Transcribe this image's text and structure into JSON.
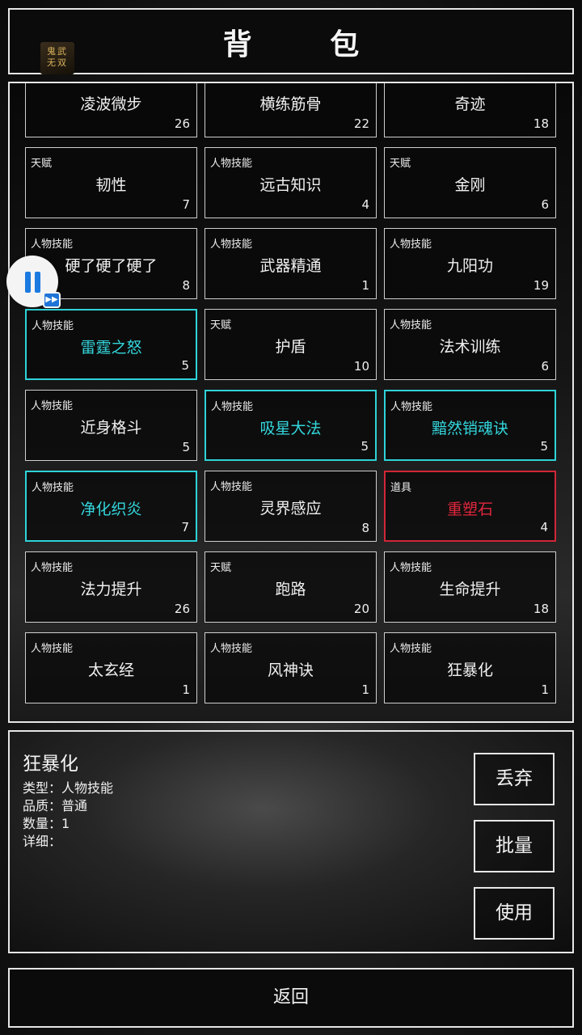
{
  "header": {
    "title": "背 包",
    "logo_lines": [
      "鬼武",
      "无双"
    ]
  },
  "items": [
    {
      "type": "",
      "name": "凌波微步",
      "count": "26",
      "style": "normal"
    },
    {
      "type": "",
      "name": "横练筋骨",
      "count": "22",
      "style": "normal"
    },
    {
      "type": "",
      "name": "奇迹",
      "count": "18",
      "style": "normal"
    },
    {
      "type": "天赋",
      "name": "韧性",
      "count": "7",
      "style": "normal"
    },
    {
      "type": "人物技能",
      "name": "远古知识",
      "count": "4",
      "style": "normal"
    },
    {
      "type": "天赋",
      "name": "金刚",
      "count": "6",
      "style": "normal"
    },
    {
      "type": "人物技能",
      "name": "硬了硬了硬了",
      "count": "8",
      "style": "normal"
    },
    {
      "type": "人物技能",
      "name": "武器精通",
      "count": "1",
      "style": "normal"
    },
    {
      "type": "人物技能",
      "name": "九阳功",
      "count": "19",
      "style": "normal"
    },
    {
      "type": "人物技能",
      "name": "雷霆之怒",
      "count": "5",
      "style": "cyan"
    },
    {
      "type": "天赋",
      "name": "护盾",
      "count": "10",
      "style": "normal"
    },
    {
      "type": "人物技能",
      "name": "法术训练",
      "count": "6",
      "style": "normal"
    },
    {
      "type": "人物技能",
      "name": "近身格斗",
      "count": "5",
      "style": "normal"
    },
    {
      "type": "人物技能",
      "name": "吸星大法",
      "count": "5",
      "style": "cyan"
    },
    {
      "type": "人物技能",
      "name": "黯然销魂诀",
      "count": "5",
      "style": "cyan"
    },
    {
      "type": "人物技能",
      "name": "净化织炎",
      "count": "7",
      "style": "cyan"
    },
    {
      "type": "人物技能",
      "name": "灵界感应",
      "count": "8",
      "style": "normal"
    },
    {
      "type": "道具",
      "name": "重塑石",
      "count": "4",
      "style": "red"
    },
    {
      "type": "人物技能",
      "name": "法力提升",
      "count": "26",
      "style": "normal"
    },
    {
      "type": "天赋",
      "name": "跑路",
      "count": "20",
      "style": "normal"
    },
    {
      "type": "人物技能",
      "name": "生命提升",
      "count": "18",
      "style": "normal"
    },
    {
      "type": "人物技能",
      "name": "太玄经",
      "count": "1",
      "style": "normal"
    },
    {
      "type": "人物技能",
      "name": "风神诀",
      "count": "1",
      "style": "normal"
    },
    {
      "type": "人物技能",
      "name": "狂暴化",
      "count": "1",
      "style": "normal"
    }
  ],
  "detail": {
    "name": "狂暴化",
    "type_line": "类型：人物技能",
    "quality_line": "品质：普通",
    "count_line": "数量：1",
    "desc_line": "详细："
  },
  "buttons": {
    "discard": "丢弃",
    "batch": "批量",
    "use": "使用"
  },
  "footer": {
    "back": "返回"
  },
  "colors": {
    "cyan": "#2ed3d8",
    "red": "#d12638",
    "border": "#e6e6e6"
  },
  "overlay": {
    "pause_icon": "pause-icon",
    "fast_forward_icon": "fast-forward-icon"
  }
}
